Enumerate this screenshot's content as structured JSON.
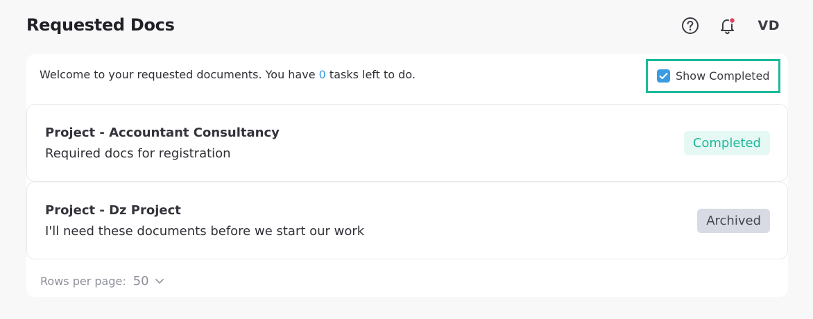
{
  "header": {
    "title": "Requested Docs",
    "avatar_initials": "VD",
    "icons": [
      "help-circle-icon",
      "bell-icon"
    ],
    "notification_dot_color": "#e0415a"
  },
  "welcome": {
    "prefix": "Welcome to your requested documents. You have ",
    "count": "0",
    "suffix": " tasks left to do."
  },
  "show_completed": {
    "label": "Show Completed",
    "checked": true
  },
  "rows": [
    {
      "title": "Project - Accountant Consultancy",
      "description": "Required docs for registration",
      "status": "Completed"
    },
    {
      "title": "Project - Dz Project",
      "description": "I'll need these documents before we start our work",
      "status": "Archived"
    }
  ],
  "pagination": {
    "label": "Rows per page:",
    "value": "50"
  },
  "colors": {
    "accent": "#3b9be0",
    "completed": "#1bb99a",
    "highlight_border": "#1bb99a",
    "archived_bg": "#d8dbe3"
  }
}
